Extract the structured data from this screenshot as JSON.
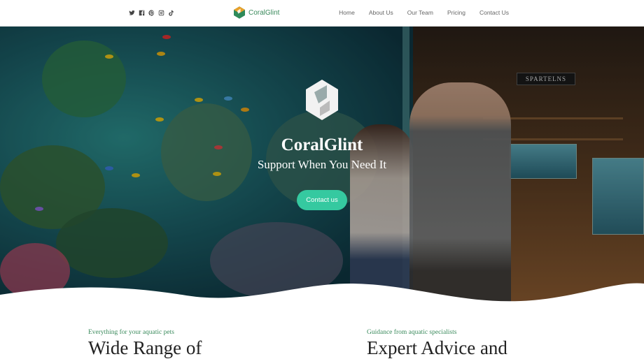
{
  "header": {
    "brand_name": "CoralGlint",
    "social_icons": [
      "twitter-icon",
      "facebook-icon",
      "pinterest-icon",
      "instagram-icon",
      "tiktok-icon"
    ],
    "nav": [
      {
        "label": "Home"
      },
      {
        "label": "About Us"
      },
      {
        "label": "Our Team"
      },
      {
        "label": "Pricing"
      },
      {
        "label": "Contact Us"
      }
    ]
  },
  "hero": {
    "title": "CoralGlint",
    "subtitle": "Support When You Need It",
    "cta_label": "Contact us",
    "store_sign": "SPARTELNS"
  },
  "features": [
    {
      "kicker": "Everything for your aquatic pets",
      "heading": "Wide Range of"
    },
    {
      "kicker": "Guidance from aquatic specialists",
      "heading": "Expert Advice and"
    }
  ],
  "colors": {
    "accent": "#35c9a0",
    "brand_green": "#3a8a5c",
    "logo_orange": "#e8a02a"
  }
}
